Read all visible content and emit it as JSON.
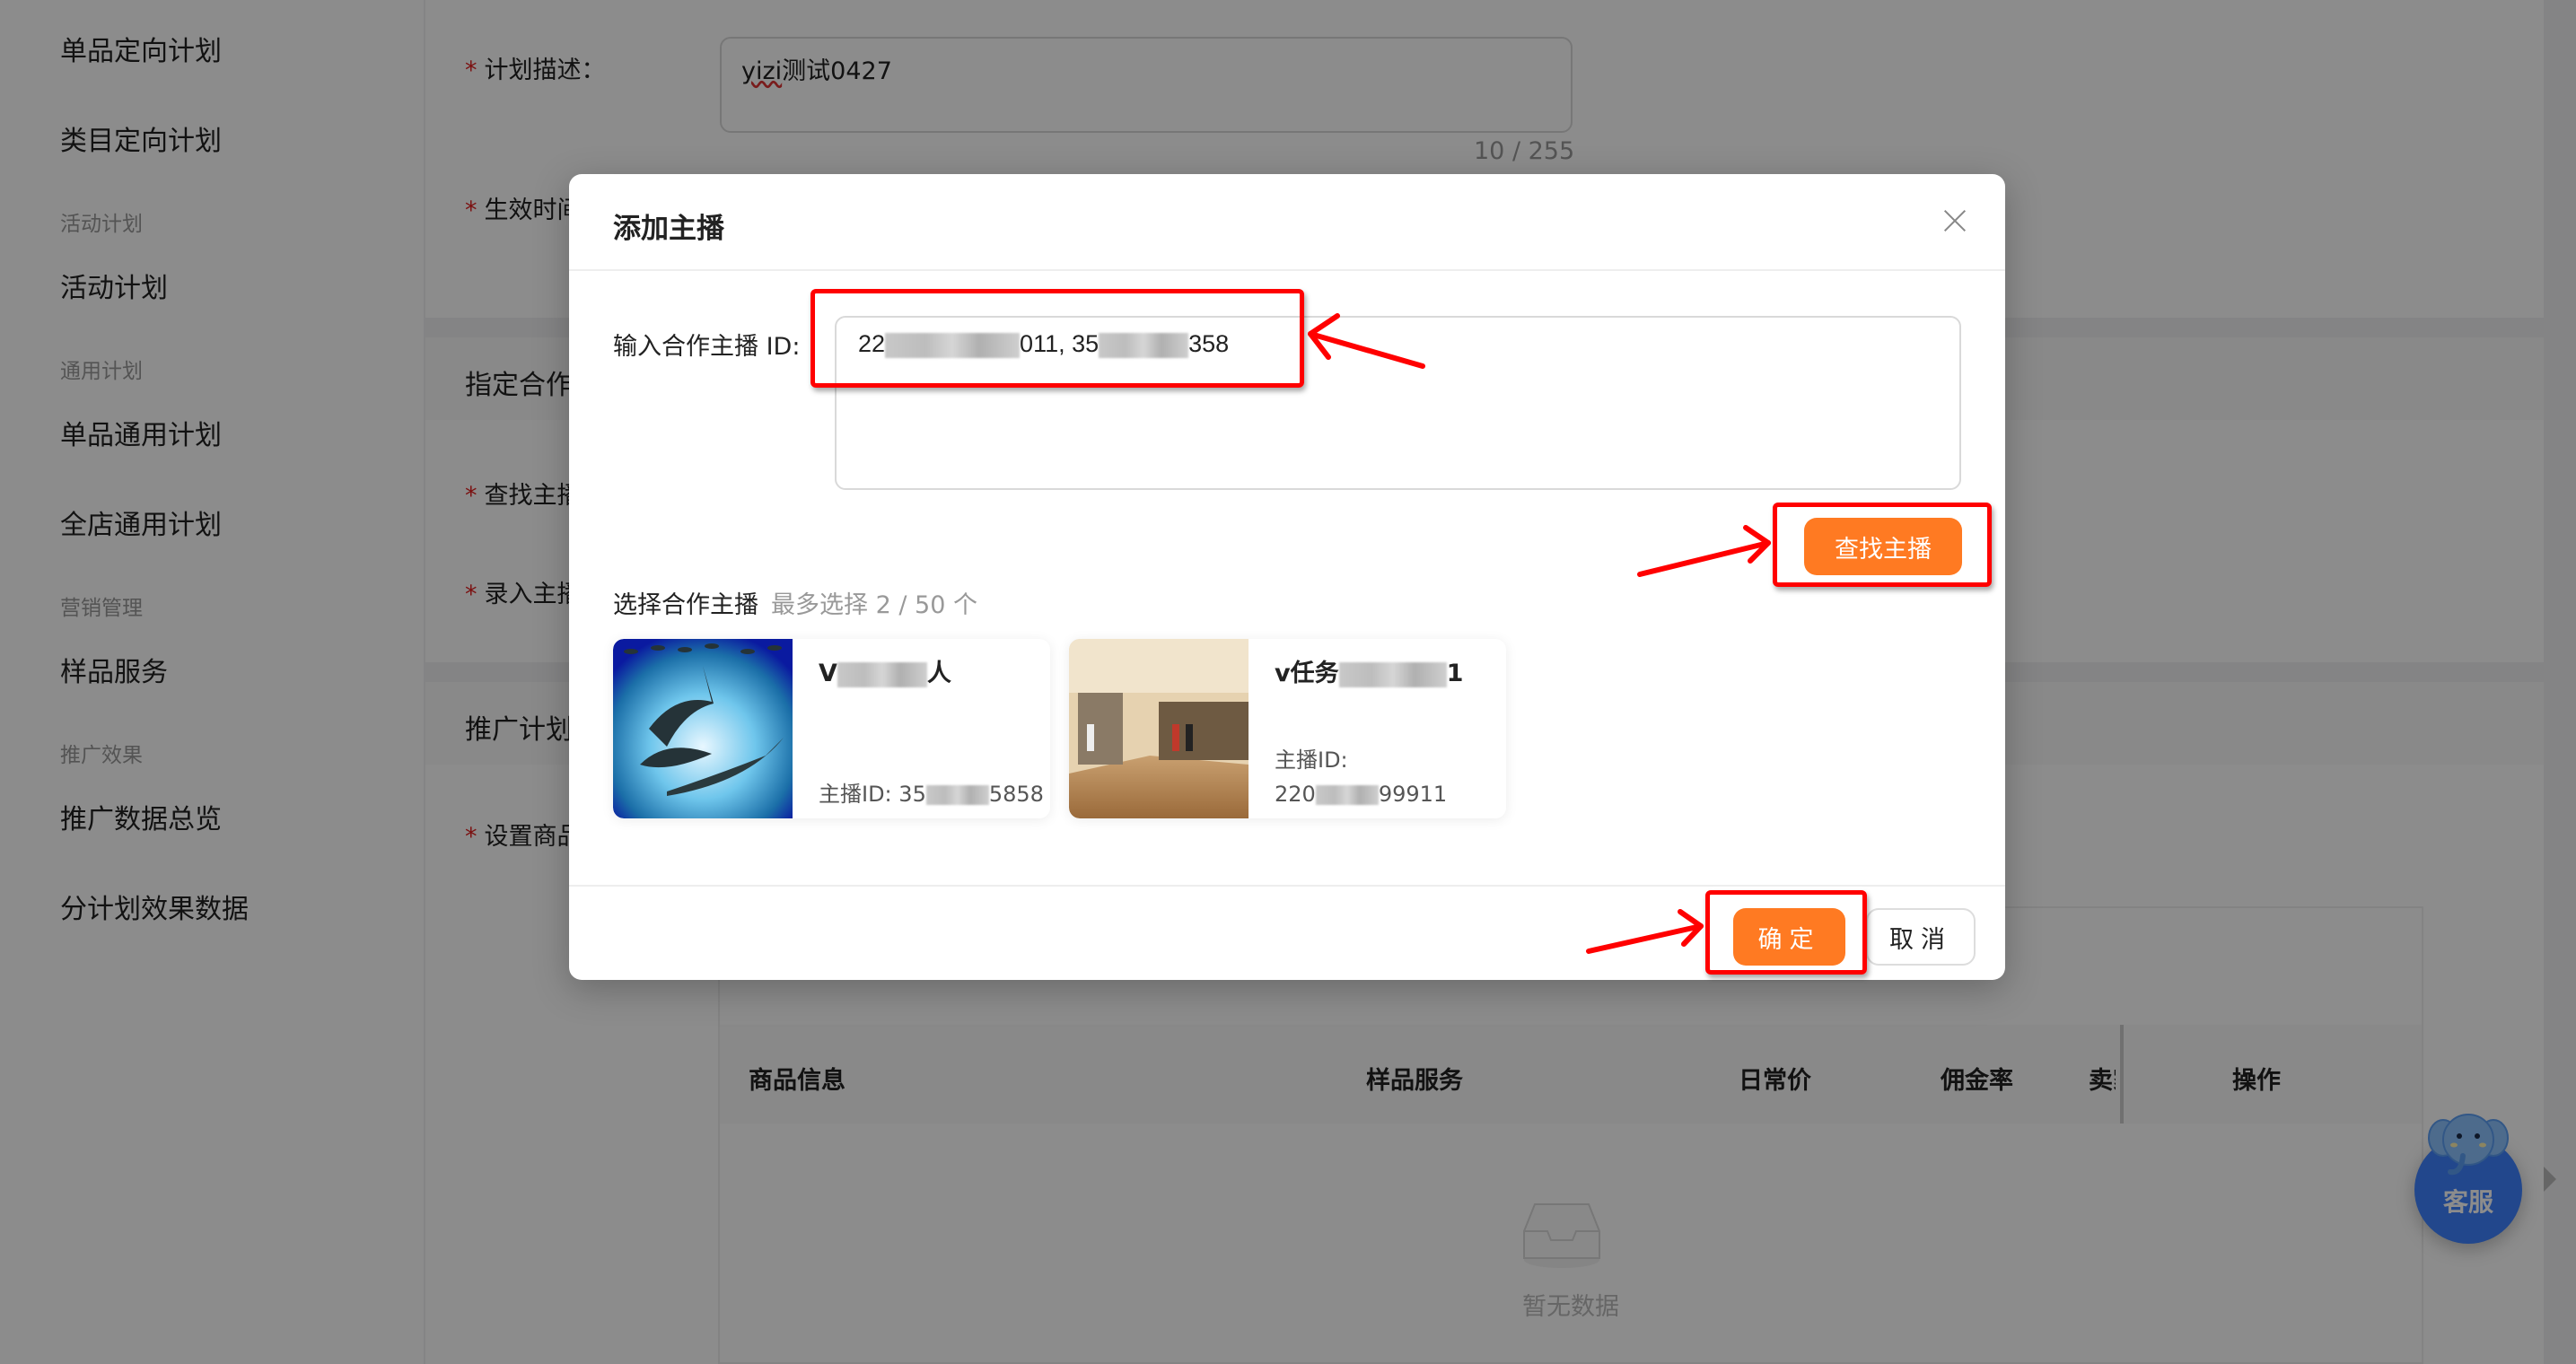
{
  "sidebar": {
    "items": [
      {
        "type": "item",
        "label": "单品定向计划"
      },
      {
        "type": "item",
        "label": "类目定向计划"
      },
      {
        "type": "group",
        "label": "活动计划"
      },
      {
        "type": "item",
        "label": "活动计划"
      },
      {
        "type": "group",
        "label": "通用计划"
      },
      {
        "type": "item",
        "label": "单品通用计划"
      },
      {
        "type": "item",
        "label": "全店通用计划"
      },
      {
        "type": "group",
        "label": "营销管理"
      },
      {
        "type": "item",
        "label": "样品服务"
      },
      {
        "type": "group",
        "label": "推广效果"
      },
      {
        "type": "item",
        "label": "推广数据总览"
      },
      {
        "type": "item",
        "label": "分计划效果数据"
      }
    ]
  },
  "form": {
    "plan_desc_label": "计划描述：",
    "plan_desc_value_spell": "yizi",
    "plan_desc_value_rest": "测试0427",
    "plan_desc_counter": "10 / 255",
    "effective_time_label": "生效时间",
    "section_partner_title": "指定合作主播",
    "find_anchor_label": "查找主播",
    "enter_anchor_label": "录入主播",
    "section_promo_title": "推广计划",
    "set_product_label": "设置商品",
    "required_mark": "*"
  },
  "product_table": {
    "columns": [
      "商品信息",
      "样品服务",
      "日常价",
      "佣金率",
      "卖家",
      "操作"
    ],
    "empty_text": "暂无数据"
  },
  "customer_service": {
    "label": "客服",
    "accent": "#3f82ff"
  },
  "modal": {
    "title": "添加主播",
    "id_input_label": "输入合作主播 ID:",
    "id_input_value_parts": [
      "22",
      "011, 35",
      "358"
    ],
    "search_button": "查找主播",
    "select_title": "选择合作主播",
    "select_hint": "最多选择 2 / 50 个",
    "selected_count": 2,
    "max_count": 50,
    "anchors": [
      {
        "name_start": "V",
        "name_end": "人",
        "id_label": "主播ID:",
        "id_start": "35",
        "id_end": "5858"
      },
      {
        "name_start": "v任务",
        "name_end": "1",
        "id_label": "主播ID:",
        "id_start": "220",
        "id_end": "99911"
      }
    ],
    "ok_button": "确定",
    "cancel_button": "取消",
    "primary_color": "#ff7a22"
  },
  "annotations": {
    "highlight_color": "#ff0000"
  }
}
